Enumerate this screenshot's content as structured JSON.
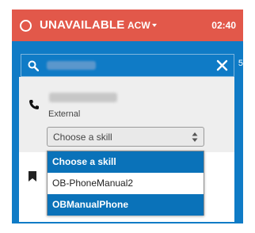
{
  "status_bar": {
    "status": "UNAVAILABLE",
    "sub_status": "ACW",
    "timer": "02:40",
    "bg_color": "#e2584a"
  },
  "header": {
    "partial_digit": "5",
    "bg_color": "#0f7bc6"
  },
  "search": {
    "value": "",
    "icon": "search-icon",
    "clear_icon": "close-icon"
  },
  "contact": {
    "type_label": "External",
    "icon": "phone-icon"
  },
  "skill_select": {
    "selected_label": "Choose a skill",
    "options": [
      {
        "label": "Choose a skill",
        "highlighted": true
      },
      {
        "label": "OB-PhoneManual2",
        "highlighted": false
      },
      {
        "label": "OBManualPhone",
        "highlighted": true
      }
    ]
  },
  "colors": {
    "accent_blue": "#0a72b9",
    "panel_grey": "#eeeeee"
  }
}
